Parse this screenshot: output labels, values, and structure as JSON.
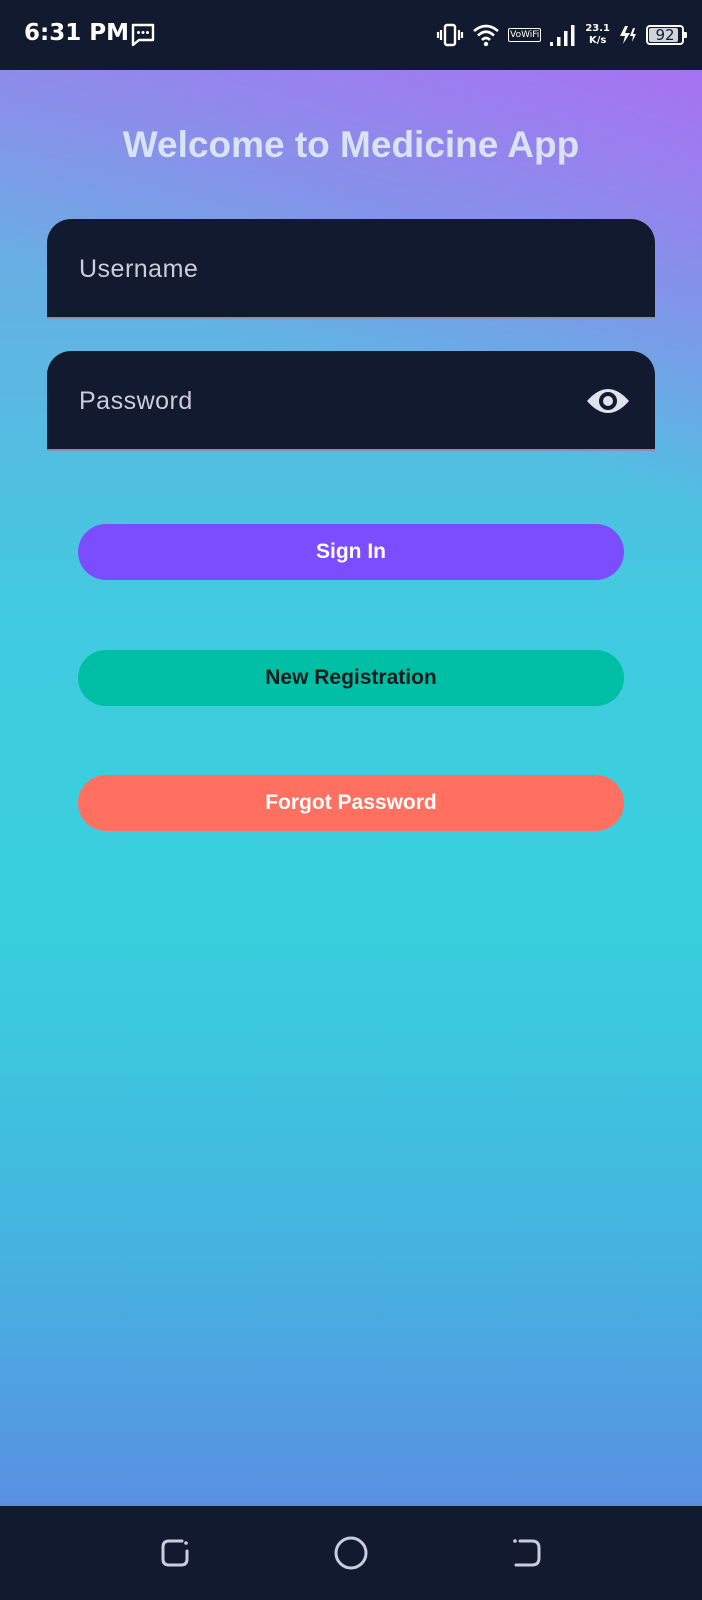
{
  "status_bar": {
    "time": "6:31 PM",
    "vowifi": "VoWiFi",
    "speed_value": "23.1",
    "speed_unit": "K/s",
    "battery": "92",
    "battery_level": 0.92
  },
  "colors": {
    "background_gradient": [
      "#a870f2",
      "#7d9fe6",
      "#38d0dd",
      "#5a90e2"
    ],
    "field_bg": "#121a2f",
    "sign_in": "#7c4dff",
    "new_registration": "#00bfa5",
    "forgot_password": "#ff7061"
  },
  "title": "Welcome to Medicine App",
  "form": {
    "username_label": "Username",
    "password_label": "Password",
    "password_toggle_icon": "eye-icon"
  },
  "buttons": {
    "sign_in": "Sign In",
    "new_registration": "New Registration",
    "forgot_password": "Forgot Password"
  },
  "nav": {
    "icons": [
      "recents-icon",
      "home-icon",
      "back-icon"
    ]
  }
}
